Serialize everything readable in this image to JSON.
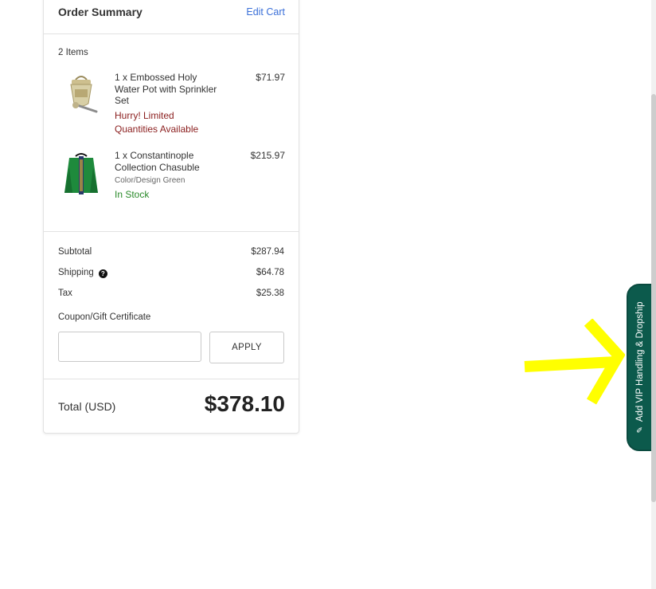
{
  "summary": {
    "title": "Order Summary",
    "edit_cart": "Edit Cart",
    "items_count": "2 Items",
    "items": [
      {
        "name": "1 x Embossed Holy Water Pot with Sprinkler Set",
        "price": "$71.97",
        "status": "Hurry! Limited Quantities Available"
      },
      {
        "name": "1 x Constantinople Collection Chasuble",
        "price": "$215.97",
        "variant": "Color/Design Green",
        "status": "In Stock"
      }
    ],
    "subtotal_label": "Subtotal",
    "subtotal": "$287.94",
    "shipping_label": "Shipping",
    "shipping": "$64.78",
    "tax_label": "Tax",
    "tax": "$25.38",
    "coupon_label": "Coupon/Gift Certificate",
    "coupon_value": "",
    "apply": "APPLY",
    "total_label": "Total (USD)",
    "total": "$378.10"
  },
  "vip_tab": {
    "label": "Add VIP Handling & Dropship"
  },
  "colors": {
    "link": "#3a6fd8",
    "warning": "#8a1d1d",
    "in_stock": "#2a8a2a",
    "vip_tab": "#0c5a4c",
    "annotation_arrow": "#ffff00"
  }
}
